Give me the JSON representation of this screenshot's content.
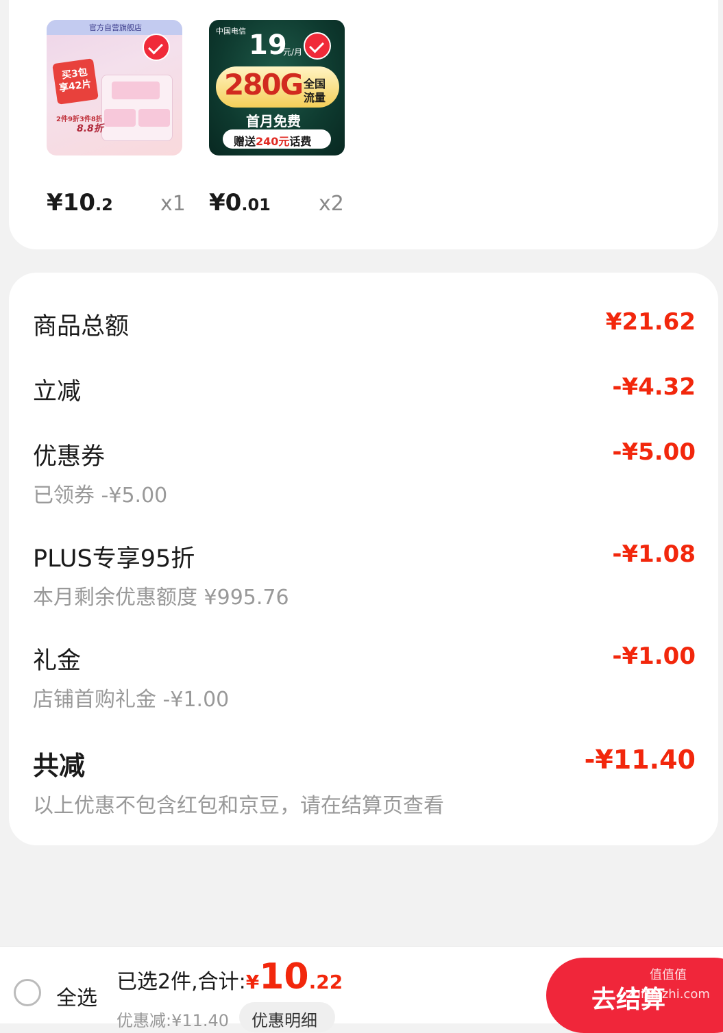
{
  "products": [
    {
      "store_tag": "官方自营旗舰店",
      "thumb_text_1": "买3包",
      "thumb_text_2": "享42片",
      "thumb_text_3": "2件9折3件8折",
      "thumb_text_4": "8.8折",
      "price_int": "¥10",
      "price_dec": ".2",
      "qty": "x1"
    },
    {
      "thumb_brand": "中国电信",
      "thumb_price": "19",
      "thumb_unit": "元/月",
      "thumb_data": "280G",
      "thumb_data_note_1": "全国",
      "thumb_data_note_2": "流量",
      "thumb_free": "首月免费",
      "thumb_gift_1": "赠送",
      "thumb_gift_amount": "240元",
      "thumb_gift_2": "话费",
      "price_int": "¥0",
      "price_dec": ".01",
      "qty": "x2"
    }
  ],
  "summary": {
    "subtotal_label": "商品总额",
    "subtotal_value": "¥21.62",
    "instant_label": "立减",
    "instant_value": "-¥4.32",
    "coupon_label": "优惠券",
    "coupon_value": "-¥5.00",
    "coupon_sub": "已领券 -¥5.00",
    "plus_label": "PLUS专享95折",
    "plus_value": "-¥1.08",
    "plus_sub": "本月剩余优惠额度 ¥995.76",
    "gift_label": "礼金",
    "gift_value": "-¥1.00",
    "gift_sub": "店铺首购礼金 -¥1.00",
    "total_label": "共减",
    "total_value": "-¥11.40",
    "note": "以上优惠不包含红包和京豆，请在结算页查看"
  },
  "bottom_bar": {
    "select_all": "全选",
    "selected_text": "已选2件,合计:",
    "currency": "¥",
    "total_int": "10",
    "total_dec": ".22",
    "discount_text": "优惠减:¥11.40",
    "details_button": "优惠明细",
    "checkout_button": "去结算"
  },
  "watermark": "值值值 zhizhizhi.com",
  "colors": {
    "accent_red": "#f2270c",
    "button_red": "#f0263a",
    "page_bg": "#f2f2f2"
  }
}
